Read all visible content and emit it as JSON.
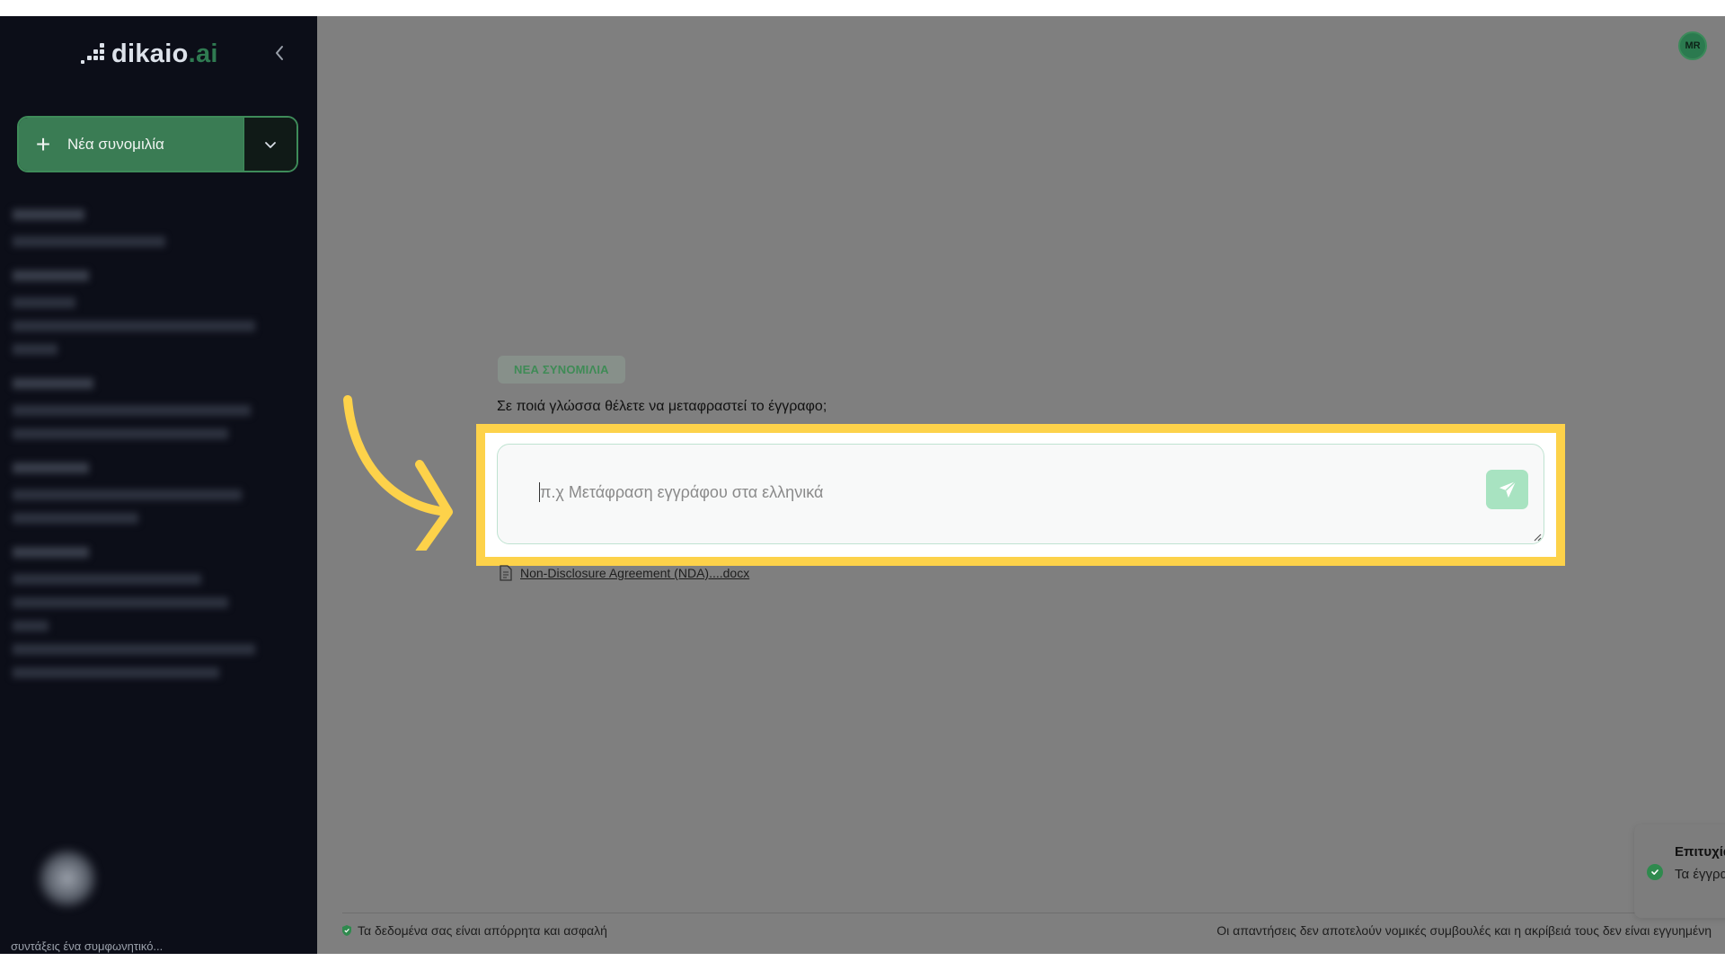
{
  "brand": {
    "name": "dikaio",
    "suffix": ".ai"
  },
  "sidebar": {
    "new_chat_label": "Νέα συνομιλία",
    "bottom_text": "συντάξεις ένα συμφωνητικό..."
  },
  "user": {
    "initials": "MR"
  },
  "chat": {
    "badge": "ΝΕΑ ΣΥΝΟΜΙΛΙΑ",
    "question": "Σε ποιά γλώσσα θέλετε να μεταφραστεί το έγγραφο;",
    "input_placeholder": "π.χ Μετάφραση εγγράφου στα ελληνικά",
    "attachment": "Non-Disclosure Agreement (NDA)....docx"
  },
  "footer": {
    "privacy": "Τα δεδομένα σας είναι απόρρητα και ασφαλή",
    "disclaimer": "Οι απαντήσεις δεν αποτελούν νομικές συμβουλές και η ακρίβειά τους δεν είναι εγγυημένη"
  },
  "toast": {
    "title": "Επιτυχία",
    "message": "Τα έγγραφα σας είναι διαθέσιμα στο νομικό βοηθό."
  },
  "colors": {
    "sidebar_bg": "#0c0e18",
    "brand_green": "#3a7c54",
    "overlay_gray": "#7f7f7f",
    "highlight_yellow": "#fdd24a",
    "send_button": "#a8e3c1"
  },
  "icons": {
    "collapse": "chevron-left-icon",
    "new_chat": "plus-icon",
    "dropdown": "chevron-down-icon",
    "send": "send-icon",
    "attachment": "document-icon",
    "privacy": "shield-icon",
    "toast": "check-circle-icon",
    "annotation": "arrow-icon"
  }
}
